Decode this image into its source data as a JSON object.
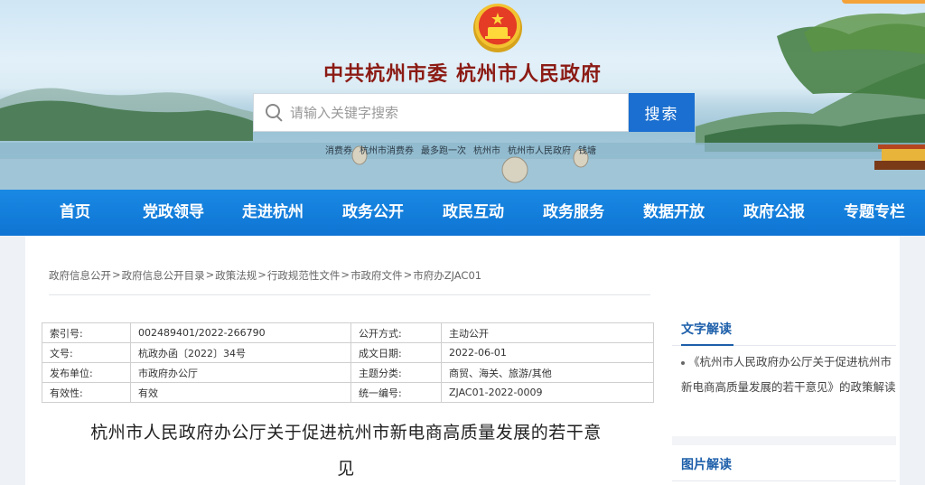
{
  "header": {
    "site_title": "中共杭州市委   杭州市人民政府",
    "search_placeholder": "请输入关键字搜索",
    "search_button": "搜索",
    "hot_words": [
      "消费券",
      "杭州市消费券",
      "最多跑一次",
      "杭州市",
      "杭州市人民政府",
      "钱塘"
    ]
  },
  "nav": {
    "items": [
      "首页",
      "党政领导",
      "走进杭州",
      "政务公开",
      "政民互动",
      "政务服务",
      "数据开放",
      "政府公报",
      "专题专栏"
    ]
  },
  "breadcrumb": [
    "政府信息公开",
    "政府信息公开目录",
    "政策法规",
    "行政规范性文件",
    "市政府文件",
    "市府办ZJAC01"
  ],
  "breadcrumb_separator": ">",
  "meta": {
    "rows": [
      {
        "k1": "索引号:",
        "v1": "002489401/2022-266790",
        "k2": "公开方式:",
        "v2": "主动公开"
      },
      {
        "k1": "文号:",
        "v1": "杭政办函〔2022〕34号",
        "k2": "成文日期:",
        "v2": "2022-06-01"
      },
      {
        "k1": "发布单位:",
        "v1": "市政府办公厅",
        "k2": "主题分类:",
        "v2": "商贸、海关、旅游/其他"
      },
      {
        "k1": "有效性:",
        "v1": "有效",
        "k2": "统一编号:",
        "v2": "ZJAC01-2022-0009"
      }
    ]
  },
  "document": {
    "title_line1": "杭州市人民政府办公厅关于促进杭州市新电商高质量发展的若干意",
    "title_line2": "见"
  },
  "sidebar": {
    "text_interpretation_title": "文字解读",
    "text_interpretation_link": "《杭州市人民政府办公厅关于促进杭州市新电商高质量发展的若干意见》的政策解读",
    "image_interpretation_title": "图片解读"
  },
  "colors": {
    "nav_blue": "#1280dc",
    "title_red": "#8b1b14",
    "search_blue": "#1b6fd0",
    "sidebar_heading": "#1d5faa"
  }
}
